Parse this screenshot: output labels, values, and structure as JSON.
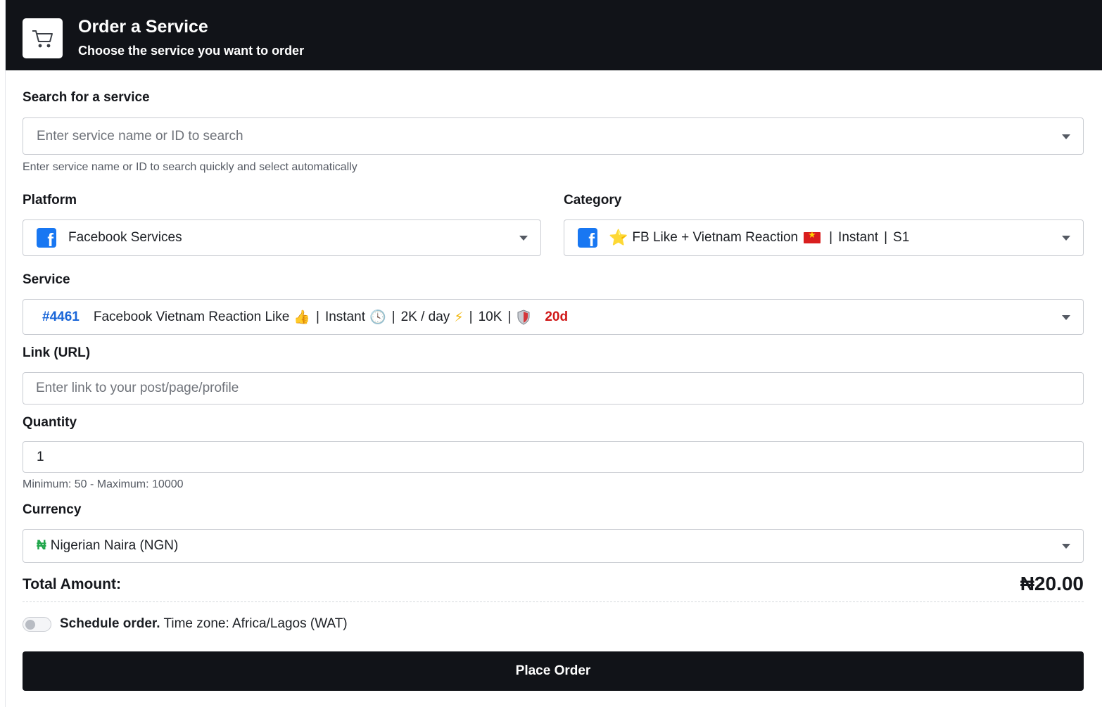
{
  "header": {
    "icon": "shopping-cart-icon",
    "title": "Order a Service",
    "subtitle": "Choose the service you want to order"
  },
  "search": {
    "label": "Search for a service",
    "placeholder": "Enter service name or ID to search",
    "help": "Enter service name or ID to search quickly and select automatically"
  },
  "platform": {
    "label": "Platform",
    "icon": "facebook-icon",
    "value": "Facebook Services"
  },
  "category": {
    "label": "Category",
    "icon": "facebook-icon",
    "star": "⭐",
    "name": "FB Like + Vietnam Reaction",
    "flag": "vietnam-flag-icon",
    "tag1": "Instant",
    "tag2": "S1"
  },
  "service": {
    "label": "Service",
    "id": "#4461",
    "name": "Facebook Vietnam Reaction Like",
    "name_emoji": "👍",
    "speed": "Instant",
    "speed_emoji": "🕓",
    "rate": "2K / day",
    "rate_emoji": "⚡",
    "max": "10K",
    "guarantee_icon": "shield-icon",
    "guarantee": "20d"
  },
  "link": {
    "label": "Link (URL)",
    "placeholder": "Enter link to your post/page/profile"
  },
  "quantity": {
    "label": "Quantity",
    "value": "1",
    "help": "Minimum: 50 - Maximum: 10000"
  },
  "currency": {
    "label": "Currency",
    "symbol": "₦",
    "value": "Nigerian Naira (NGN)"
  },
  "total": {
    "label": "Total Amount:",
    "value": "₦20.00"
  },
  "schedule": {
    "label": "Schedule order.",
    "timezone": "Time zone: Africa/Lagos (WAT)",
    "enabled": false
  },
  "submit": {
    "label": "Place Order"
  },
  "colors": {
    "header_bg": "#111318",
    "service_id": "#1a66d8",
    "guarantee": "#d01818",
    "naira": "#1fa64a",
    "facebook": "#1877f2"
  }
}
